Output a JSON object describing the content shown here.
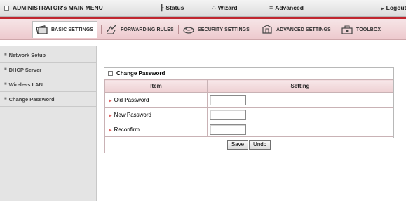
{
  "topbar": {
    "title": "ADMINISTRATOR's MAIN MENU",
    "status": "Status",
    "wizard": "Wizard",
    "advanced": "Advanced",
    "logout": "Logout"
  },
  "tabs": [
    {
      "label": "BASIC SETTINGS",
      "icon": "basic-settings-icon",
      "active": true
    },
    {
      "label": "FORWARDING RULES",
      "icon": "forwarding-rules-icon",
      "active": false
    },
    {
      "label": "SECURITY SETTINGS",
      "icon": "security-settings-icon",
      "active": false
    },
    {
      "label": "ADVANCED SETTINGS",
      "icon": "advanced-settings-icon",
      "active": false
    },
    {
      "label": "TOOLBOX",
      "icon": "toolbox-icon",
      "active": false
    }
  ],
  "sidebar": {
    "items": [
      {
        "label": "Network Setup"
      },
      {
        "label": "DHCP Server"
      },
      {
        "label": "Wireless LAN"
      },
      {
        "label": "Change Password"
      }
    ]
  },
  "panel": {
    "title": "Change Password",
    "col_item": "Item",
    "col_setting": "Setting",
    "rows": [
      {
        "label": "Old Password",
        "value": ""
      },
      {
        "label": "New Password",
        "value": ""
      },
      {
        "label": "Reconfirm",
        "value": ""
      }
    ],
    "save": "Save",
    "undo": "Undo"
  },
  "colors": {
    "accent_red": "#c0262f",
    "tab_bar_pink": "#edc9cd",
    "sidebar_gray": "#e4e4e4"
  }
}
